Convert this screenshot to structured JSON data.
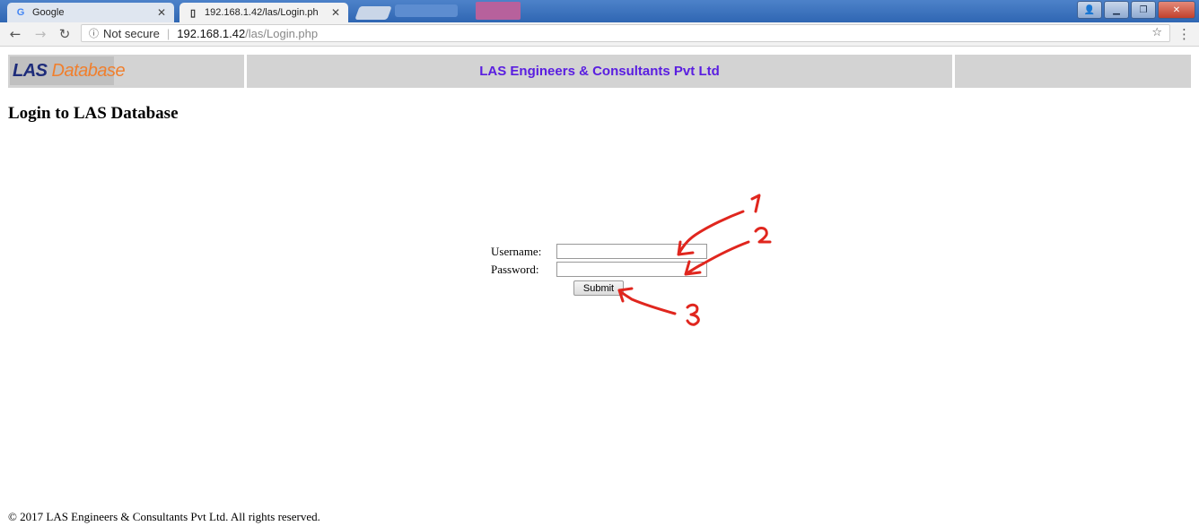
{
  "browser": {
    "tabs": [
      {
        "title": "Google",
        "favicon": "google-g-icon",
        "active": false
      },
      {
        "title": "192.168.1.42/las/Login.ph",
        "favicon": "page-icon",
        "active": true
      }
    ],
    "security_label": "Not secure",
    "url_host": "192.168.1.42",
    "url_path": "/las/Login.php"
  },
  "header": {
    "logo_las": "LAS",
    "logo_database": "Database",
    "company_name": "LAS Engineers & Consultants Pvt Ltd",
    "colors": {
      "band": "#d3d3d3",
      "company": "#5a1ee0",
      "logo_las": "#1e2c7a",
      "logo_database": "#f07f2d"
    }
  },
  "page": {
    "title": "Login to LAS Database"
  },
  "form": {
    "username_label": "Username:",
    "username_value": "",
    "password_label": "Password:",
    "password_value": "",
    "submit_label": "Submit"
  },
  "annotations": {
    "marks": [
      "1",
      "2",
      "3"
    ],
    "color": "#e0261e"
  },
  "footer": {
    "text": "© 2017 LAS Engineers & Consultants Pvt Ltd. All rights reserved."
  }
}
